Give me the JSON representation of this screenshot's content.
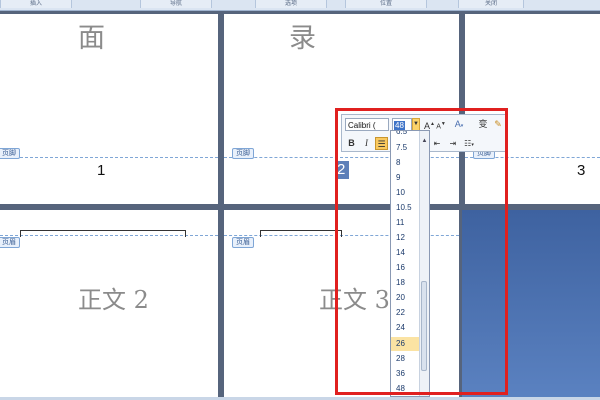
{
  "ribbon": {
    "tabs": [
      "插入",
      "导航",
      "选项",
      "位置",
      "关闭"
    ]
  },
  "pages": {
    "top_left_char": "面",
    "top_mid_char": "录",
    "page_numbers": [
      "1",
      "2",
      "3"
    ],
    "footer_tag": "页脚",
    "header_tag": "页眉",
    "body_left": "正文 2",
    "body_mid": "正文 3"
  },
  "mini_toolbar": {
    "font_name": "Calibri (",
    "font_size": "48",
    "grow_font_label": "A",
    "shrink_font_label": "A",
    "bold_label": "B",
    "italic_label": "I",
    "style_label": "变"
  },
  "font_size_dropdown": {
    "top_partial": "6.5",
    "options": [
      "7.5",
      "8",
      "9",
      "10",
      "10.5",
      "11",
      "12",
      "14",
      "16",
      "18",
      "20",
      "22",
      "24",
      "26",
      "28",
      "36",
      "48"
    ],
    "highlighted": "26"
  },
  "colors": {
    "red_frame": "#e0201f",
    "highlight": "#fbe3a3",
    "background": "#56647c"
  }
}
